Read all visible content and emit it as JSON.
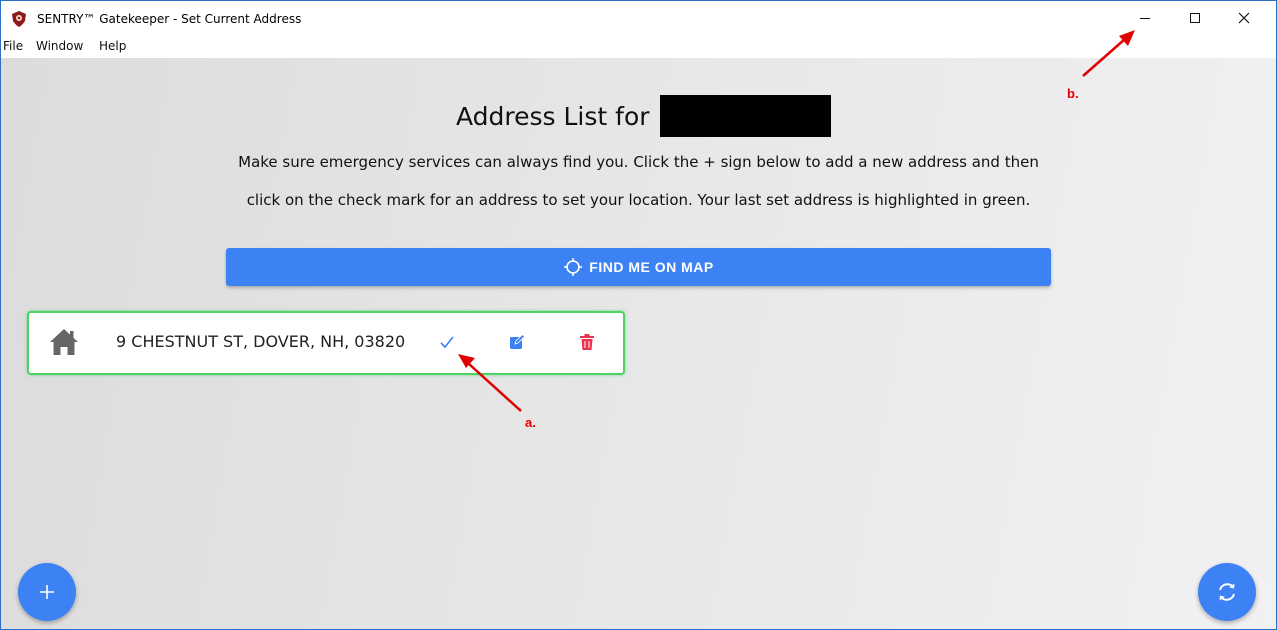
{
  "window": {
    "title": "SENTRY™ Gatekeeper - Set Current Address",
    "controls": [
      "minimize-icon",
      "maximize-icon",
      "close-icon"
    ]
  },
  "menu": {
    "items": [
      "File",
      "Window",
      "Help"
    ]
  },
  "main": {
    "heading": "Address List for",
    "description_line1": "Make sure emergency services can always find you. Click the + sign below to add a new address and then",
    "description_line2": "click on the check mark for an address to set your location. Your last set address is highlighted in green.",
    "find_button": {
      "label": "FIND ME ON MAP",
      "icon": "crosshair-icon"
    }
  },
  "addresses": [
    {
      "icon": "house-icon",
      "text": "9 CHESTNUT ST, DOVER, NH, 03820",
      "highlighted": true,
      "actions": [
        "check-icon",
        "edit-icon",
        "trash-icon"
      ]
    }
  ],
  "annotations": {
    "a": "a.",
    "b": "b."
  },
  "fabs": {
    "add": "plus-icon",
    "refresh": "refresh-icon"
  },
  "colors": {
    "accent": "#3c82f5",
    "highlight": "#4ed266",
    "delete": "#e8344e",
    "annotation": "#e00000"
  }
}
